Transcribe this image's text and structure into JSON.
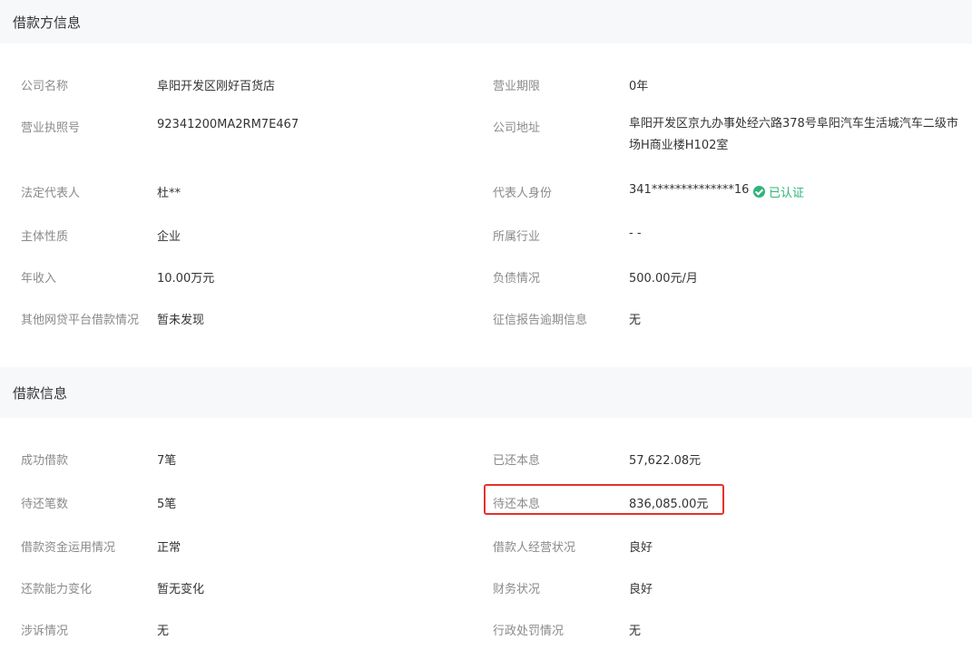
{
  "borrower": {
    "title": "借款方信息",
    "rows": [
      {
        "l1": "公司名称",
        "v1": "阜阳开发区刚好百货店",
        "l2": "营业期限",
        "v2": "0年"
      },
      {
        "l1": "营业执照号",
        "v1": "92341200MA2RM7E467",
        "l2": "公司地址",
        "v2": "阜阳开发区京九办事处经六路378号阜阳汽车生活城汽车二级市场H商业楼H102室"
      },
      {
        "l1": "法定代表人",
        "v1": "杜**",
        "l2": "代表人身份",
        "v2": "341**************16",
        "badge": "已认证"
      },
      {
        "l1": "主体性质",
        "v1": "企业",
        "l2": "所属行业",
        "v2": "- -"
      },
      {
        "l1": "年收入",
        "v1": "10.00万元",
        "l2": "负债情况",
        "v2": "500.00元/月"
      },
      {
        "l1": "其他网贷平台借款情况",
        "v1": "暂未发现",
        "l2": "征信报告逾期信息",
        "v2": "无"
      }
    ]
  },
  "loan": {
    "title": "借款信息",
    "rows": [
      {
        "l1": "成功借款",
        "v1": "7笔",
        "l2": "已还本息",
        "v2": "57,622.08元"
      },
      {
        "l1": "待还笔数",
        "v1": "5笔",
        "l2": "待还本息",
        "v2": "836,085.00元"
      },
      {
        "l1": "借款资金运用情况",
        "v1": "正常",
        "l2": "借款人经营状况",
        "v2": "良好"
      },
      {
        "l1": "还款能力变化",
        "v1": "暂无变化",
        "l2": "财务状况",
        "v2": "良好"
      },
      {
        "l1": "涉诉情况",
        "v1": "无",
        "l2": "行政处罚情况",
        "v2": "无"
      }
    ]
  },
  "colors": {
    "accent_verified": "#2fb37a",
    "highlight": "#e5322d"
  }
}
